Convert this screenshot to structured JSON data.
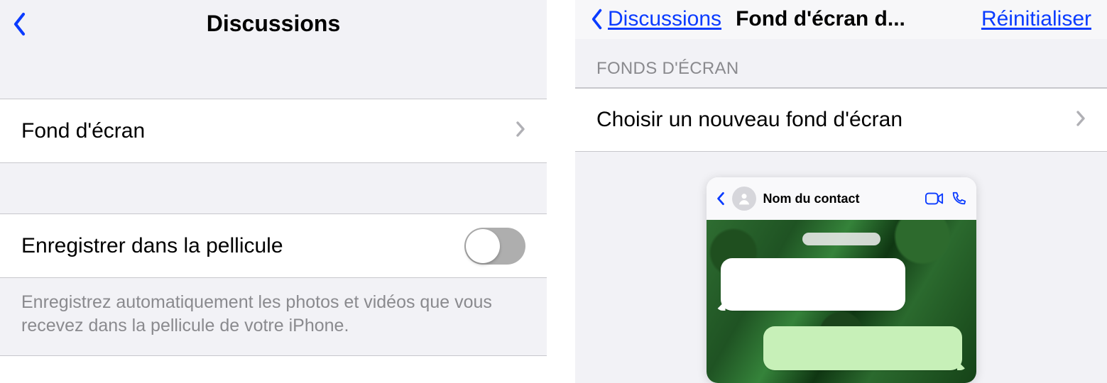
{
  "left": {
    "header_title": "Discussions",
    "wallpaper_label": "Fond d'écran",
    "save_roll_label": "Enregistrer dans la pellicule",
    "save_roll_toggle": false,
    "save_roll_help": "Enregistrez automatiquement les photos et vidéos que vous recevez dans la pellicule de votre iPhone."
  },
  "right": {
    "back_label": "Discussions",
    "header_title": "Fond d'écran d...",
    "reset_label": "Réinitialiser",
    "section_title": "FONDS D'ÉCRAN",
    "choose_label": "Choisir un nouveau fond d'écran",
    "preview": {
      "contact_name": "Nom du contact"
    }
  }
}
